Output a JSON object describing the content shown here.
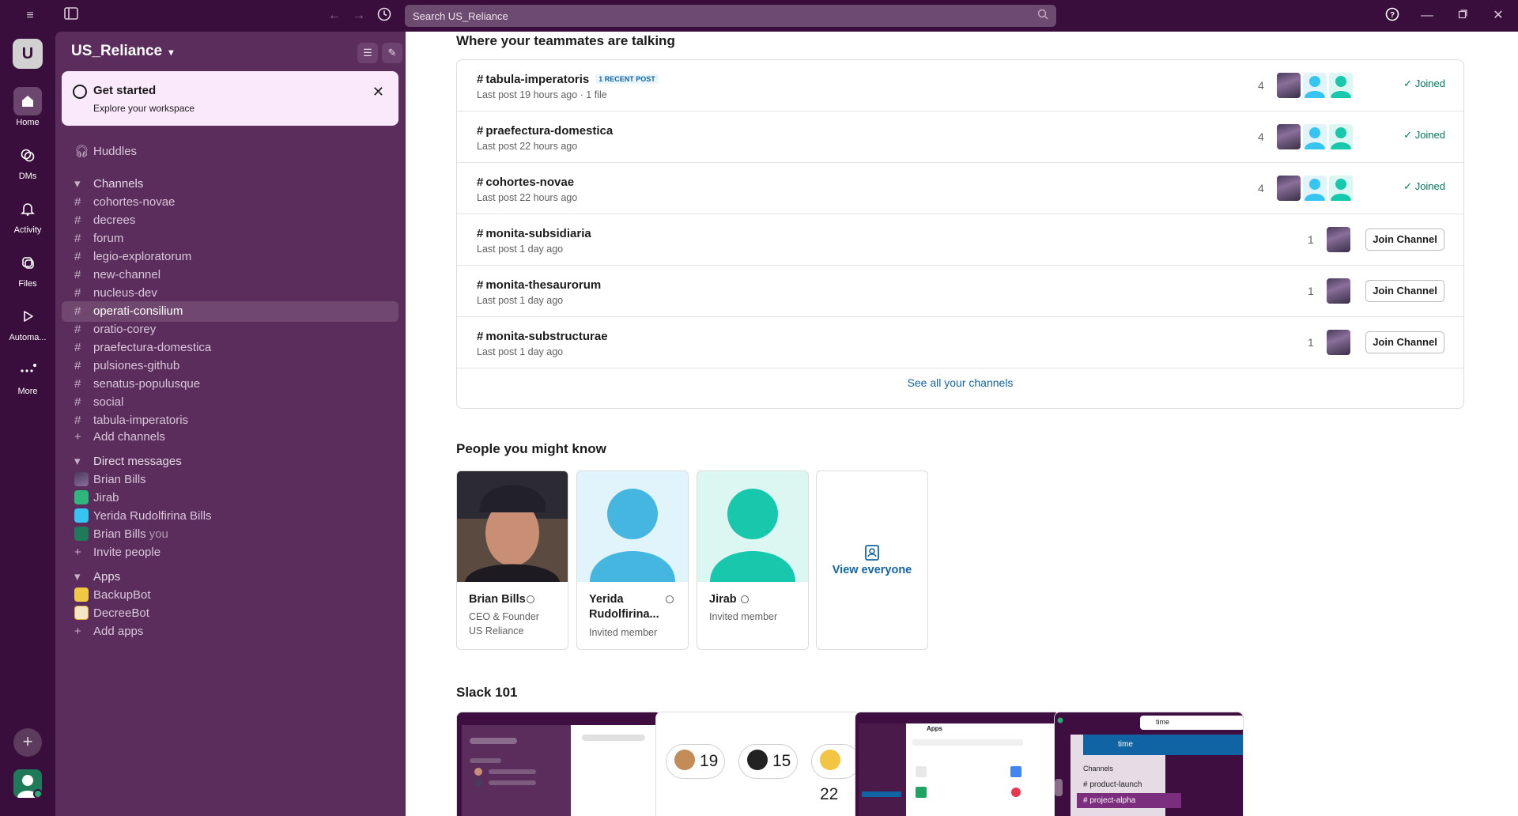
{
  "topbar": {
    "search_placeholder": "Search US_Reliance"
  },
  "rail": {
    "workspace_initial": "U",
    "items": [
      {
        "label": "Home"
      },
      {
        "label": "DMs"
      },
      {
        "label": "Activity"
      },
      {
        "label": "Files"
      },
      {
        "label": "Automa..."
      },
      {
        "label": "More"
      }
    ]
  },
  "sidebar": {
    "workspace_name": "US_Reliance",
    "get_started": {
      "title": "Get started",
      "subtitle": "Explore your workspace"
    },
    "huddles": "Huddles",
    "channels_header": "Channels",
    "channels": [
      "cohortes-novae",
      "decrees",
      "forum",
      "legio-exploratorum",
      "new-channel",
      "nucleus-dev",
      "operati-consilium",
      "oratio-corey",
      "praefectura-domestica",
      "pulsiones-github",
      "senatus-populusque",
      "social",
      "tabula-imperatoris"
    ],
    "active_channel": "operati-consilium",
    "add_channels": "Add channels",
    "dm_header": "Direct messages",
    "dms": [
      {
        "name": "Brian Bills"
      },
      {
        "name": "Jirab"
      },
      {
        "name": "Yerida Rudolfirina Bills"
      },
      {
        "name": "Brian Bills",
        "suffix": "you"
      }
    ],
    "invite_people": "Invite people",
    "apps_header": "Apps",
    "apps": [
      "BackupBot",
      "DecreeBot"
    ],
    "add_apps": "Add apps"
  },
  "main": {
    "teammates_title": "Where your teammates are talking",
    "channel_rows": [
      {
        "name": "tabula-imperatoris",
        "badge": "1 RECENT POST",
        "meta": "Last post 19 hours ago  ·  1 file",
        "count": "4",
        "status": "Joined"
      },
      {
        "name": "praefectura-domestica",
        "badge": "",
        "meta": "Last post 22 hours ago",
        "count": "4",
        "status": "Joined"
      },
      {
        "name": "cohortes-novae",
        "badge": "",
        "meta": "Last post 22 hours ago",
        "count": "4",
        "status": "Joined"
      },
      {
        "name": "monita-subsidiaria",
        "badge": "",
        "meta": "Last post 1 day ago",
        "count": "1",
        "status": "Join Channel"
      },
      {
        "name": "monita-thesaurorum",
        "badge": "",
        "meta": "Last post 1 day ago",
        "count": "1",
        "status": "Join Channel"
      },
      {
        "name": "monita-substructurae",
        "badge": "",
        "meta": "Last post 1 day ago",
        "count": "1",
        "status": "Join Channel"
      }
    ],
    "see_all": "See all your channels",
    "people_title": "People you might know",
    "people": [
      {
        "name": "Brian Bills",
        "line1": "CEO & Founder",
        "line2": "US Reliance"
      },
      {
        "name": "Yerida Rudolfirina...",
        "line1": "Invited member",
        "line2": ""
      },
      {
        "name": "Jirab",
        "line1": "Invited member",
        "line2": ""
      }
    ],
    "view_everyone": "View everyone",
    "slack101_title": "Slack 101",
    "emoji_counts": [
      "19",
      "15",
      "22"
    ],
    "card4": {
      "search_text": "time",
      "result": "time",
      "section": "Channels",
      "ch1": "product-launch",
      "ch2": "project-alpha"
    },
    "card3": {
      "title": "Apps"
    }
  },
  "colors": {
    "aubergine": "#3f0e40",
    "sidebar": "#5b2d5c",
    "link": "#1264a3",
    "joined": "#007a5a",
    "cyan_avatar": "#36c5f0",
    "teal_avatar": "#2eb67d"
  }
}
